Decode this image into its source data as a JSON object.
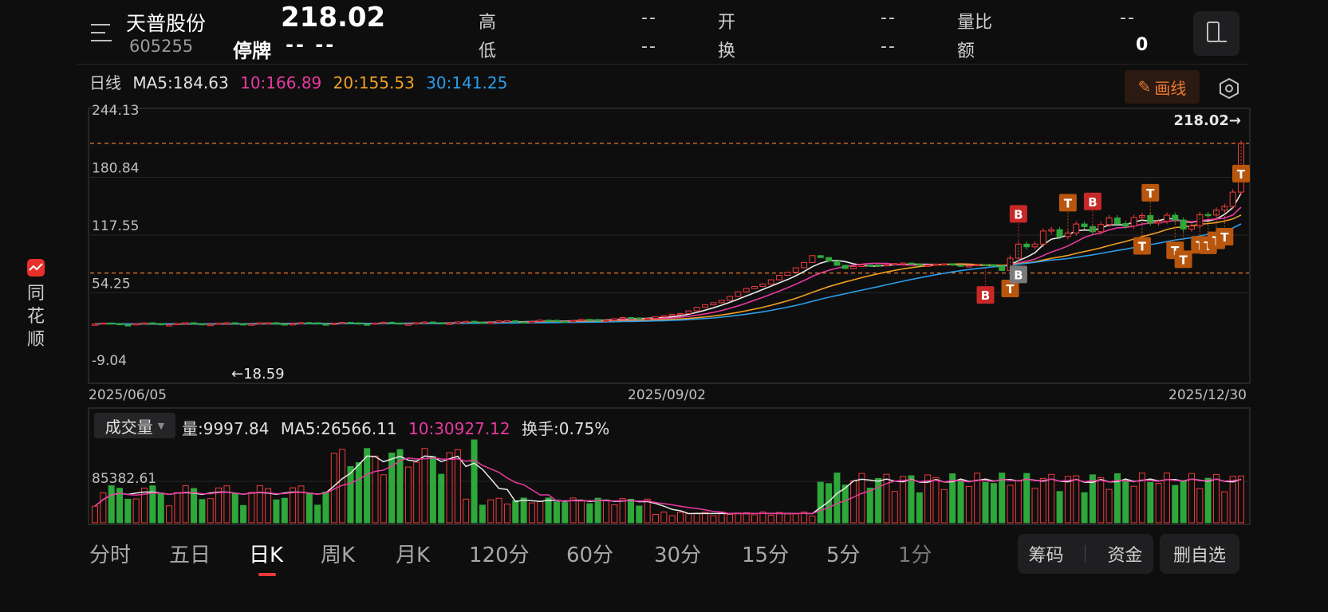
{
  "header": {
    "stock_name": "天普股份",
    "stock_code": "605255",
    "price": "218.02",
    "status": "停牌",
    "change": "-- --",
    "fields": [
      {
        "label": "高",
        "value": "--"
      },
      {
        "label": "开",
        "value": "--"
      },
      {
        "label": "量比",
        "value": "--"
      },
      {
        "label": "低",
        "value": "--"
      },
      {
        "label": "换",
        "value": "--"
      },
      {
        "label": "额",
        "value": "0"
      }
    ]
  },
  "indicators": {
    "period": "日线",
    "ma5": "MA5:184.63",
    "ma10": "10:166.89",
    "ma20": "20:155.53",
    "ma30": "30:141.25",
    "draw_button": "画线"
  },
  "side_brand": {
    "chars": [
      "同",
      "花",
      "顺"
    ]
  },
  "colors": {
    "up": "#f03a3a",
    "down": "#2ea83a",
    "ma5": "#e8e8e8",
    "ma10": "#e83aa0",
    "ma20": "#f0a020",
    "ma30": "#2a9de8",
    "dashed": "#f07a20",
    "marker_t": "#b8560e",
    "marker_b_red": "#c82828",
    "marker_b_gray": "#7a7a7a"
  },
  "chart_data": [
    {
      "type": "candlestick",
      "title": "日线",
      "y_labels": [
        "244.13",
        "180.84",
        "117.55",
        "54.25",
        "-9.04"
      ],
      "ylim": [
        -9.04,
        244.13
      ],
      "x_labels": [
        "2025/06/05",
        "2025/09/02",
        "2025/12/30"
      ],
      "last_price_label": "218.02→",
      "low_label": "←18.59",
      "reference_lines": [
        218.02,
        76.0
      ],
      "series": [
        {
          "name": "MA5",
          "value": 184.63
        },
        {
          "name": "MA10",
          "value": 166.89
        },
        {
          "name": "MA20",
          "value": 155.53
        },
        {
          "name": "MA30",
          "value": 141.25
        }
      ],
      "markers": [
        {
          "label": "B"
        },
        {
          "label": "T"
        },
        {
          "label": "B"
        },
        {
          "label": "T"
        },
        {
          "label": "T"
        },
        {
          "label": "B"
        },
        {
          "label": "T"
        },
        {
          "label": "B"
        },
        {
          "label": "T"
        },
        {
          "label": "T"
        },
        {
          "label": "T"
        },
        {
          "label": "T"
        },
        {
          "label": "T"
        },
        {
          "label": "T"
        },
        {
          "label": "T"
        }
      ]
    },
    {
      "type": "bar",
      "title": "成交量",
      "y_label": "85382.61",
      "stats": {
        "volume": "量:9997.84",
        "ma5": "MA5:26566.11",
        "ma10": "10:30927.12",
        "turnover": "换手:0.75%"
      }
    }
  ],
  "tabs": [
    "分时",
    "五日",
    "日K",
    "周K",
    "月K",
    "120分",
    "60分",
    "30分",
    "15分",
    "5分",
    "1分"
  ],
  "active_tab": "日K",
  "bottom_buttons": {
    "chips": "筹码",
    "funds": "资金",
    "remove": "删自选"
  }
}
